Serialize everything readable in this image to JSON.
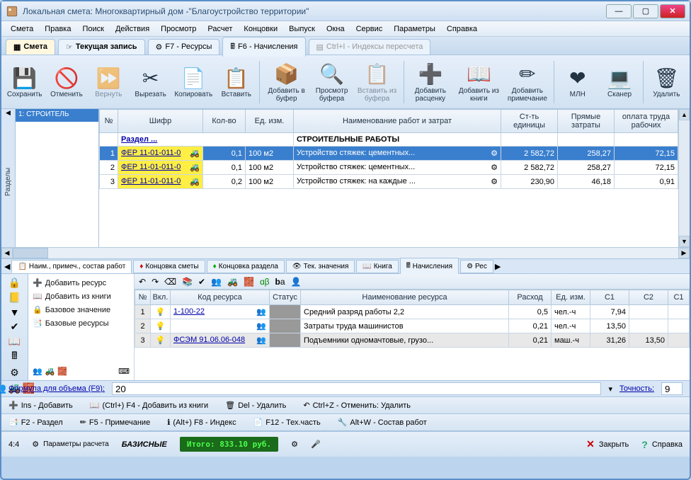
{
  "window": {
    "title": "Локальная смета: Многоквартирный дом -\"Благоустройство территории\""
  },
  "menu": [
    "Смета",
    "Правка",
    "Поиск",
    "Действия",
    "Просмотр",
    "Расчет",
    "Концовки",
    "Выпуск",
    "Окна",
    "Сервис",
    "Параметры",
    "Справка"
  ],
  "tabs": [
    {
      "label": "Смета",
      "active": true
    },
    {
      "label": "Текущая запись",
      "active": false
    },
    {
      "label": "F7 - Ресурсы",
      "active": false
    },
    {
      "label": "F6 - Начисления",
      "active": false
    },
    {
      "label": "Ctrl+I - Индексы пересчета",
      "active": false,
      "disabled": true
    }
  ],
  "toolbar": [
    {
      "id": "save",
      "label": "Сохранить",
      "icon": "save"
    },
    {
      "id": "cancel",
      "label": "Отменить",
      "icon": "cancel"
    },
    {
      "id": "redo",
      "label": "Вернуть",
      "icon": "redo",
      "disabled": true
    },
    {
      "id": "cut",
      "label": "Вырезать",
      "icon": "cut"
    },
    {
      "id": "copy",
      "label": "Копировать",
      "icon": "copy"
    },
    {
      "id": "paste",
      "label": "Вставить",
      "icon": "paste"
    },
    "sep",
    {
      "id": "addbuf",
      "label": "Добавить в буфер",
      "icon": "addbuf",
      "wide": true
    },
    {
      "id": "viewbuf",
      "label": "Просмотр буфера",
      "icon": "viewbuf"
    },
    {
      "id": "pastebuf",
      "label": "Вставить из буфера",
      "icon": "pastebuf",
      "disabled": true,
      "wide": true
    },
    "sep",
    {
      "id": "addrate",
      "label": "Добавить расценку",
      "icon": "plus",
      "wide": true
    },
    {
      "id": "addbook",
      "label": "Добавить из книги",
      "icon": "book",
      "wide": true
    },
    {
      "id": "addnote",
      "label": "Добавить примечание",
      "icon": "note",
      "wide": true
    },
    "sep",
    {
      "id": "mln",
      "label": "МЛН",
      "icon": "heart"
    },
    {
      "id": "scan",
      "label": "Сканер",
      "icon": "scan"
    },
    "sep",
    {
      "id": "del",
      "label": "Удалить",
      "icon": "trash"
    }
  ],
  "sidebar": {
    "vlabel": "Разделы",
    "section_head": "1: СТРОИТЕЛЬ"
  },
  "grid": {
    "headers": [
      "№",
      "Шифр",
      "Кол-во",
      "Ед. изм.",
      "Наименование работ и затрат",
      "Ст-ть единицы",
      "Прямые затраты",
      "оплата труда рабочих"
    ],
    "section_label": "Раздел ...",
    "section_title": "СТРОИТЕЛЬНЫЕ РАБОТЫ",
    "rows": [
      {
        "n": "1",
        "code": "ФЕР 11-01-011-0",
        "qty": "0,1",
        "unit": "100 м2",
        "name": "Устройство стяжек: цементных...",
        "cost": "2 582,72",
        "direct": "258,27",
        "labor": "72,15",
        "sel": true
      },
      {
        "n": "2",
        "code": "ФЕР 11-01-011-0",
        "qty": "0,1",
        "unit": "100 м2",
        "name": "Устройство стяжек: цементных...",
        "cost": "2 582,72",
        "direct": "258,27",
        "labor": "72,15"
      },
      {
        "n": "3",
        "code": "ФЕР 11-01-011-0",
        "qty": "0,2",
        "unit": "100 м2",
        "name": "Устройство стяжек: на каждые ...",
        "cost": "230,90",
        "direct": "46,18",
        "labor": "0,91"
      }
    ]
  },
  "detail_tabs": [
    "Наим., примеч., состав работ",
    "Концовка сметы",
    "Концовка раздела",
    "Тек. значения",
    "Книга",
    "Начисления",
    "Рес"
  ],
  "res_actions": [
    "Добавить ресурс",
    "Добавить из книги",
    "Базовое значение",
    "Базовые ресурсы"
  ],
  "res_grid": {
    "headers": [
      "№",
      "Вкл.",
      "Код ресурса",
      "Статус",
      "Наименование ресурса",
      "Расход",
      "Ед. изм.",
      "С1",
      "С2",
      "С1"
    ],
    "rows": [
      {
        "n": "1",
        "on": "💡",
        "code": "1-100-22",
        "name": "Средний разряд работы 2,2",
        "rate": "0,5",
        "unit": "чел.-ч",
        "c1": "7,94",
        "c2": ""
      },
      {
        "n": "2",
        "on": "💡",
        "code": "",
        "name": "Затраты труда машинистов",
        "rate": "0,21",
        "unit": "чел.-ч",
        "c1": "13,50",
        "c2": ""
      },
      {
        "n": "3",
        "on": "💡",
        "code": "ФСЭМ 91.06.06-048",
        "name": "Подъемники одномачтовые, грузо...",
        "rate": "0,21",
        "unit": "маш.-ч",
        "c1": "31,26",
        "c2": "13,50",
        "sel": true
      }
    ]
  },
  "formula": {
    "label": "Формула для объема (F9):",
    "value": "20",
    "precision_label": "Точность:",
    "precision": "9"
  },
  "bottom_rows": [
    [
      {
        "icon": "➕",
        "label": "Ins - Добавить"
      },
      {
        "icon": "📖",
        "label": "(Ctrl+) F4 - Добавить из книги"
      },
      {
        "icon": "🗑",
        "label": "Del - Удалить"
      },
      {
        "icon": "↶",
        "label": "Ctrl+Z - Отменить: Удалить"
      }
    ],
    [
      {
        "icon": "📑",
        "label": "F2 - Раздел"
      },
      {
        "icon": "✏",
        "label": "F5 - Примечание"
      },
      {
        "icon": "ℹ",
        "label": "(Alt+) F8 - Индекс"
      },
      {
        "icon": "📄",
        "label": "F12 - Тех.часть"
      },
      {
        "icon": "🔧",
        "label": "Alt+W - Состав работ"
      }
    ]
  ],
  "status": {
    "pos": "4:4",
    "params": "Параметры расчета",
    "basis": "БАЗИСНЫЕ",
    "total": "Итого: 833.10 руб.",
    "close": "Закрыть",
    "help": "Справка"
  }
}
